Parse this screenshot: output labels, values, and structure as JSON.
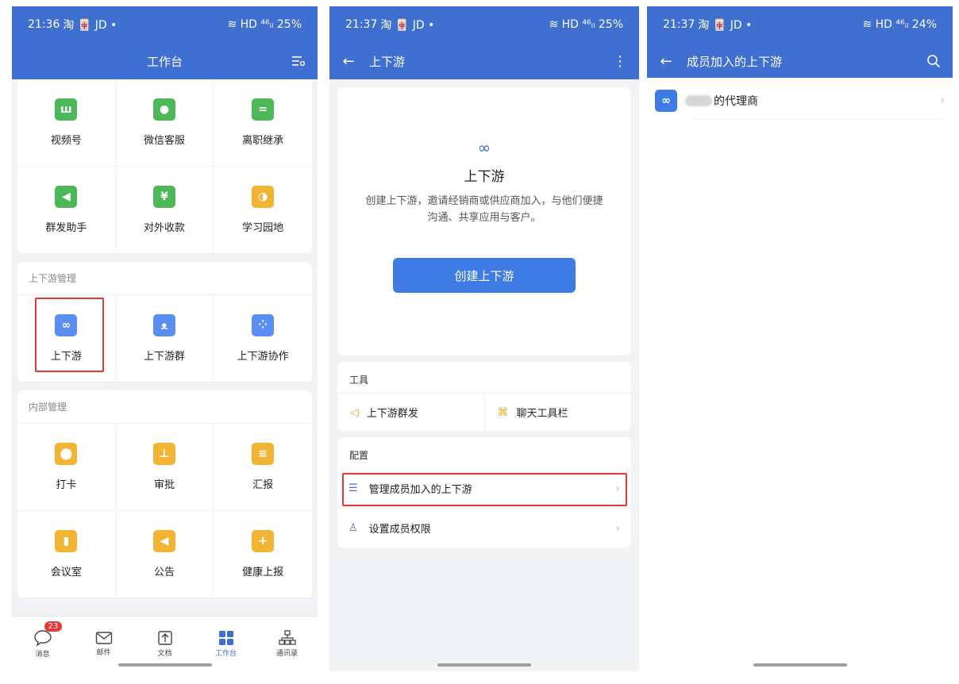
{
  "p1": {
    "status": {
      "time": "21:36",
      "apps": "淘 🀄 JD •",
      "right": "≋ HD ⁴⁶ᵢₗ 25%"
    },
    "title": "工作台",
    "grid1": [
      {
        "label": "视频号",
        "color": "#4cb857",
        "glyph": "ꟺ"
      },
      {
        "label": "微信客服",
        "color": "#4cb857",
        "glyph": "●"
      },
      {
        "label": "离职继承",
        "color": "#4cb857",
        "glyph": "="
      },
      {
        "label": "群发助手",
        "color": "#4cb857",
        "glyph": "◀"
      },
      {
        "label": "对外收款",
        "color": "#4cb857",
        "glyph": "¥"
      },
      {
        "label": "学习园地",
        "color": "#f1b434",
        "glyph": "◑"
      }
    ],
    "section_updown": "上下游管理",
    "grid2": [
      {
        "label": "上下游",
        "color": "#5b8ef2",
        "glyph": "∞"
      },
      {
        "label": "上下游群",
        "color": "#5b8ef2",
        "glyph": "ᴥ"
      },
      {
        "label": "上下游协作",
        "color": "#5b8ef2",
        "glyph": "⁘"
      }
    ],
    "section_internal": "内部管理",
    "grid3": [
      {
        "label": "打卡",
        "color": "#f1b434",
        "glyph": "⬤"
      },
      {
        "label": "审批",
        "color": "#f1b434",
        "glyph": "⊥"
      },
      {
        "label": "汇报",
        "color": "#f1b434",
        "glyph": "≡"
      },
      {
        "label": "会议室",
        "color": "#f1b434",
        "glyph": "▮"
      },
      {
        "label": "公告",
        "color": "#f1b434",
        "glyph": "◀"
      },
      {
        "label": "健康上报",
        "color": "#f1b434",
        "glyph": "+"
      }
    ],
    "tabs": [
      {
        "label": "消息",
        "badge": "23"
      },
      {
        "label": "邮件"
      },
      {
        "label": "文档"
      },
      {
        "label": "工作台"
      },
      {
        "label": "通讯录"
      }
    ]
  },
  "p2": {
    "status": {
      "time": "21:37",
      "apps": "淘 🀄 JD •",
      "right": "≋ HD ⁴⁶ᵢₗ 25%"
    },
    "title": "上下游",
    "info_title": "上下游",
    "info_desc": "创建上下游，邀请经销商或供应商加入，与他们便捷沟通、共享应用与客户。",
    "create_btn": "创建上下游",
    "tools_label": "工具",
    "tool1": "上下游群发",
    "tool2": "聊天工具栏",
    "config_label": "配置",
    "row1": "管理成员加入的上下游",
    "row2": "设置成员权限"
  },
  "p3": {
    "status": {
      "time": "21:37",
      "apps": "淘 🀄 JD •",
      "right": "≋ HD ⁴⁶ᵢₗ 24%"
    },
    "title": "成员加入的上下游",
    "item_suffix": "的代理商"
  },
  "colors": {
    "brand": "#3f6fd0",
    "highlight": "#e53935"
  }
}
